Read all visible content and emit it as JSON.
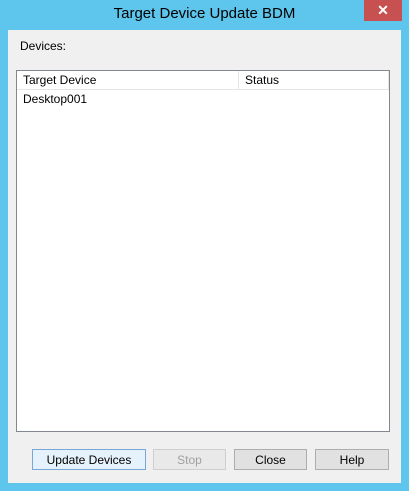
{
  "window": {
    "title": "Target Device Update BDM",
    "close_glyph": "✕"
  },
  "devices": {
    "label": "Devices:",
    "columns": [
      "Target Device",
      "Status"
    ],
    "rows": [
      {
        "target_device": "Desktop001",
        "status": ""
      }
    ]
  },
  "buttons": {
    "update": "Update Devices",
    "stop": "Stop",
    "close": "Close",
    "help": "Help"
  },
  "colors": {
    "frame": "#5ec6ec",
    "close_button": "#c75050",
    "client": "#f0f0f0"
  }
}
